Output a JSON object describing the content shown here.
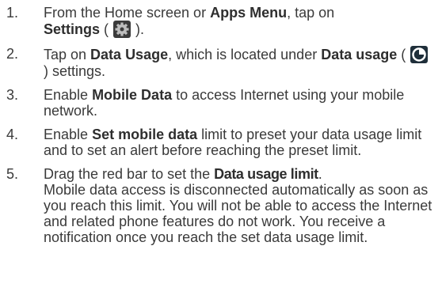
{
  "steps": [
    {
      "number": "1.",
      "parts": {
        "a": "From the Home screen or ",
        "b": "Apps Menu",
        "c": ", tap on ",
        "d": "Settings",
        "e": " ( ",
        "f": " )."
      },
      "icon": "settings-gear-icon"
    },
    {
      "number": "2.",
      "parts": {
        "a": "Tap on ",
        "b": "Data Usage",
        "c": ", which is located under ",
        "d": "Data usage",
        "e": " ( ",
        "f": " ) settings."
      },
      "icon": "data-usage-icon"
    },
    {
      "number": "3.",
      "parts": {
        "a": "Enable ",
        "b": "Mobile Data",
        "c": " to access Internet using your mobile network."
      }
    },
    {
      "number": "4.",
      "parts": {
        "a": "Enable ",
        "b": "Set mobile data",
        "c": " limit to preset your data usage limit and to set an alert before reaching the preset limit."
      }
    },
    {
      "number": "5.",
      "parts": {
        "a": "Drag the red bar to set the ",
        "b": "Data usage limit",
        "c": ".",
        "d": "Mobile data access is disconnected automatically as soon as you reach this limit. You will not be able to access the Internet and related phone features do not work. You receive a notification once you reach the set data usage limit."
      }
    }
  ],
  "colors": {
    "text": "#3a3a3a",
    "gear_icon": "#6b6b6b",
    "data_icon": "#1f2f3a"
  }
}
